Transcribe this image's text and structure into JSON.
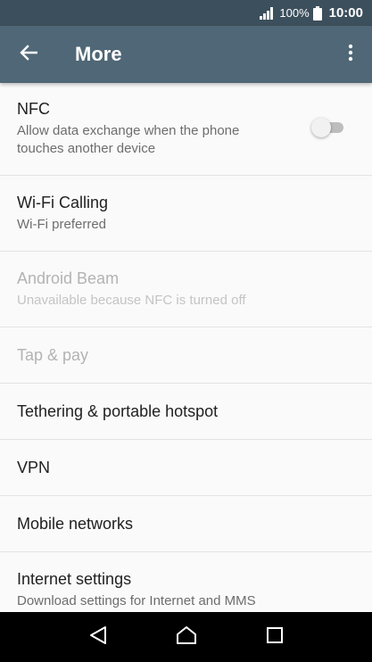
{
  "status_bar": {
    "signal_icon": "signal-icon",
    "battery_percent": "100%",
    "battery_icon": "battery-icon",
    "time": "10:00"
  },
  "app_bar": {
    "back_icon": "arrow-back-icon",
    "title": "More",
    "overflow_icon": "more-vert-icon",
    "background": "#4f6776"
  },
  "items": [
    {
      "label": "NFC",
      "summary": "Allow data exchange when the phone touches another device",
      "enabled": true,
      "toggle": {
        "on": false
      }
    },
    {
      "label": "Wi-Fi Calling",
      "summary": "Wi-Fi preferred",
      "enabled": true
    },
    {
      "label": "Android Beam",
      "summary": "Unavailable because NFC is turned off",
      "enabled": false
    },
    {
      "label": "Tap & pay",
      "enabled": false
    },
    {
      "label": "Tethering & portable hotspot",
      "enabled": true
    },
    {
      "label": "VPN",
      "enabled": true
    },
    {
      "label": "Mobile networks",
      "enabled": true
    },
    {
      "label": "Internet settings",
      "summary": "Download settings for Internet and MMS",
      "enabled": true
    }
  ],
  "nav_bar": {
    "back_icon": "nav-back-icon",
    "home_icon": "nav-home-icon",
    "recents_icon": "nav-recents-icon"
  }
}
